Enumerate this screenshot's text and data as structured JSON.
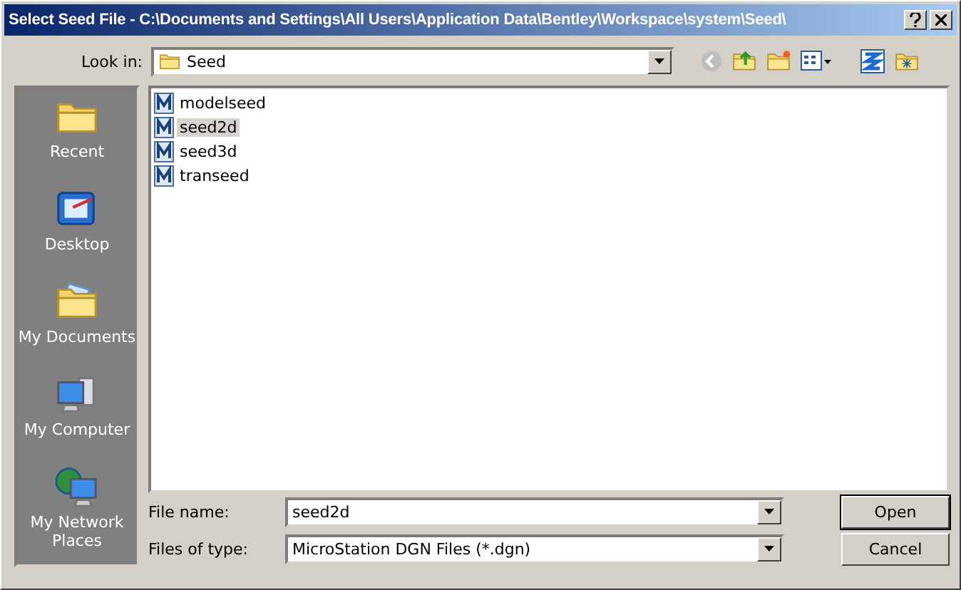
{
  "window": {
    "title": "Select Seed File - C:\\Documents and Settings\\All Users\\Application Data\\Bentley\\Workspace\\system\\Seed\\"
  },
  "look_in": {
    "label": "Look in:",
    "value": "Seed"
  },
  "places": [
    {
      "kind": "recent",
      "label": "Recent"
    },
    {
      "kind": "desktop",
      "label": "Desktop"
    },
    {
      "kind": "documents",
      "label": "My Documents"
    },
    {
      "kind": "computer",
      "label": "My Computer"
    },
    {
      "kind": "network",
      "label": "My Network Places"
    }
  ],
  "files": [
    {
      "name": "modelseed",
      "selected": false
    },
    {
      "name": "seed2d",
      "selected": true
    },
    {
      "name": "seed3d",
      "selected": false
    },
    {
      "name": "transeed",
      "selected": false
    }
  ],
  "file_name": {
    "label": "File name:",
    "value": "seed2d"
  },
  "file_type": {
    "label": "Files of type:",
    "value": "MicroStation DGN Files (*.dgn)"
  },
  "buttons": [
    "Open",
    "Cancel"
  ]
}
